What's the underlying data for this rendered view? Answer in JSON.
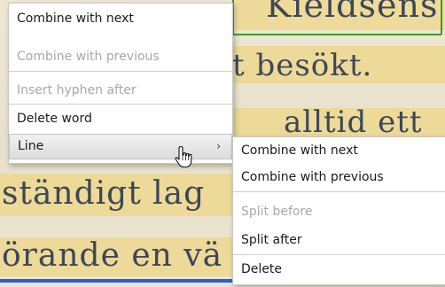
{
  "document": {
    "lines": [
      "Kieldsens",
      "t besökt.",
      "alltid  ett",
      "ständigt  lag",
      "örande en vä"
    ],
    "colors": {
      "highlight": "#eed26c",
      "selection_border": "#3a9b2a",
      "underline": "#2b5bd9"
    }
  },
  "context_menu": {
    "items": [
      {
        "label": "Combine with next",
        "enabled": true
      },
      {
        "label": "Combine with previous",
        "enabled": false
      },
      {
        "label": "Insert hyphen after",
        "enabled": false
      },
      {
        "label": "Delete word",
        "enabled": true
      },
      {
        "label": "Line",
        "enabled": true,
        "submenu_arrow": "›"
      }
    ]
  },
  "line_submenu": {
    "items": [
      {
        "label": "Combine with next",
        "enabled": true
      },
      {
        "label": "Combine with previous",
        "enabled": true
      },
      {
        "label": "Split before",
        "enabled": false
      },
      {
        "label": "Split after",
        "enabled": true
      },
      {
        "label": "Delete",
        "enabled": true
      }
    ]
  },
  "cursor": {
    "icon": "hand-pointer-icon"
  }
}
